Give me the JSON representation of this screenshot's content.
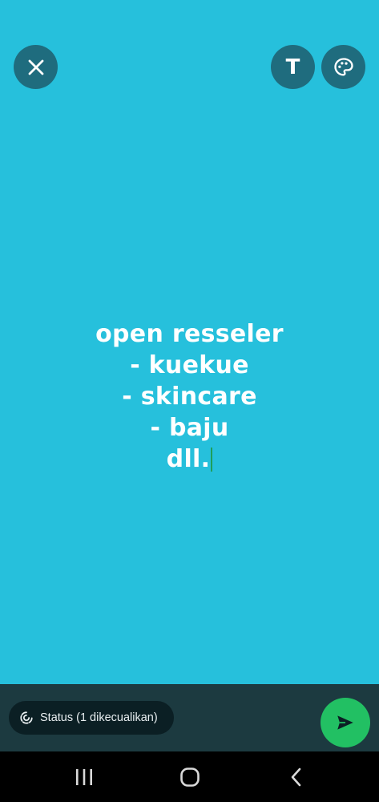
{
  "canvas": {
    "background_color": "#26C0DC",
    "text_lines": [
      "open resseler",
      "- kuekue",
      "- skincare",
      "- baju",
      "dll."
    ],
    "text_color": "#FFFFFF",
    "caret_color": "#1F9E5A"
  },
  "toolbar": {
    "close_icon": "close-icon",
    "text_tool_label": "T",
    "palette_icon": "palette-icon"
  },
  "bottom_bar": {
    "audience_label": "Status (1 dikecualikan)",
    "audience_icon": "status-ring-icon",
    "send_icon": "send-icon",
    "send_color": "#22C063"
  },
  "nav_bar": {
    "recents_icon": "recents-icon",
    "home_icon": "home-icon",
    "back_icon": "back-icon"
  }
}
